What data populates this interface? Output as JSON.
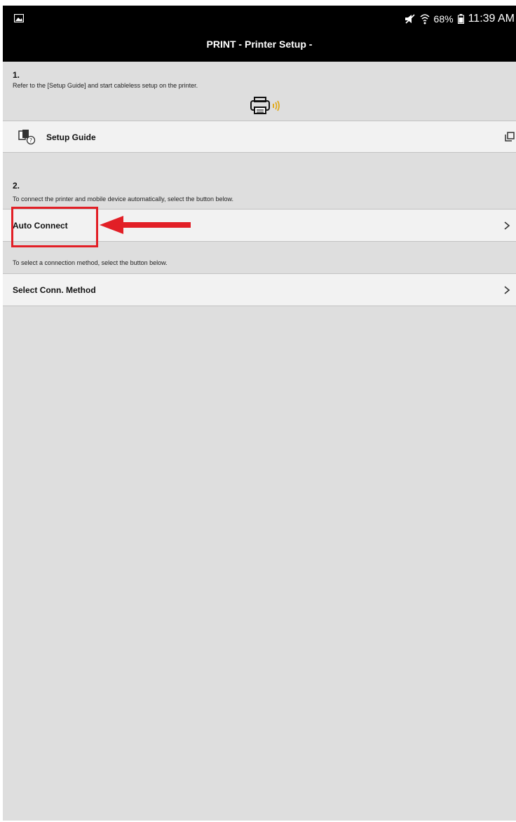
{
  "status_bar": {
    "battery": "68%",
    "time": "11:39 AM"
  },
  "header": {
    "title": "PRINT  - Printer Setup -"
  },
  "step1": {
    "number": "1.",
    "instruction": "Refer to the [Setup Guide] and start cableless setup on the printer.",
    "setup_guide_label": "Setup Guide"
  },
  "step2": {
    "number": "2.",
    "instruction": "To connect the printer and mobile device automatically, select the button below.",
    "auto_connect_label": "Auto Connect",
    "select_instruction": "To select a connection method, select the button below.",
    "select_method_label": "Select Conn. Method"
  },
  "colors": {
    "annotation": "#e21f26",
    "printer_wave": "#e0a91c"
  },
  "icons": {
    "status_left": "image-icon",
    "status_right": [
      "mute-icon",
      "wifi-icon",
      "battery-icon"
    ],
    "printer": "printer-wireless-icon",
    "setup_guide": "guide-help-icon",
    "external": "open-external-icon",
    "row_chevron": "chevron-right-icon"
  }
}
